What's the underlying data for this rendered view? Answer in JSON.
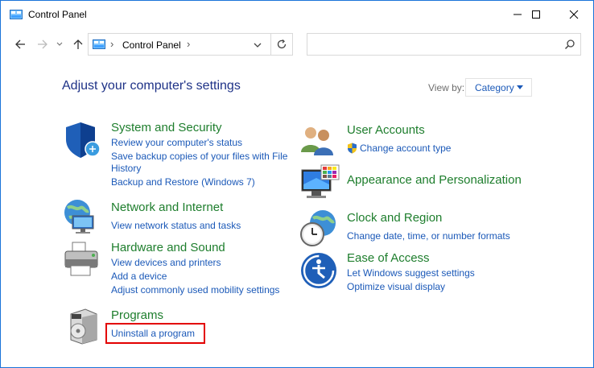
{
  "window": {
    "title": "Control Panel",
    "controls": {
      "minimize": "minimize-icon",
      "maximize": "maximize-icon",
      "close": "close-icon"
    }
  },
  "nav": {
    "breadcrumb": "Control Panel",
    "search_placeholder": ""
  },
  "main": {
    "heading": "Adjust your computer's settings",
    "view_by_label": "View by:",
    "view_by_value": "Category"
  },
  "categories": {
    "system_security": {
      "title": "System and Security",
      "icon": "shield-icon",
      "links": [
        "Review your computer's status",
        "Save backup copies of your files with File",
        "History",
        "Backup and Restore (Windows 7)"
      ]
    },
    "network": {
      "title": "Network and Internet",
      "icon": "network-globe-icon",
      "links": [
        "View network status and tasks"
      ]
    },
    "hardware": {
      "title": "Hardware and Sound",
      "icon": "printer-icon",
      "links": [
        "View devices and printers",
        "Add a device",
        "Adjust commonly used mobility settings"
      ]
    },
    "programs": {
      "title": "Programs",
      "icon": "programs-box-icon",
      "links": [
        "Uninstall a program"
      ]
    },
    "user_accounts": {
      "title": "User Accounts",
      "icon": "users-icon",
      "links": [
        "Change account type"
      ]
    },
    "appearance": {
      "title": "Appearance and Personalization",
      "icon": "monitor-palette-icon",
      "links": []
    },
    "clock": {
      "title": "Clock and Region",
      "icon": "clock-globe-icon",
      "links": [
        "Change date, time, or number formats"
      ]
    },
    "ease": {
      "title": "Ease of Access",
      "icon": "ease-of-access-icon",
      "links": [
        "Let Windows suggest settings",
        "Optimize visual display"
      ]
    }
  },
  "colors": {
    "heading": "#1e3287",
    "category_title": "#1e7e2d",
    "link": "#1b59b8",
    "highlight": "#e30000",
    "window_border": "#1a73d9"
  }
}
